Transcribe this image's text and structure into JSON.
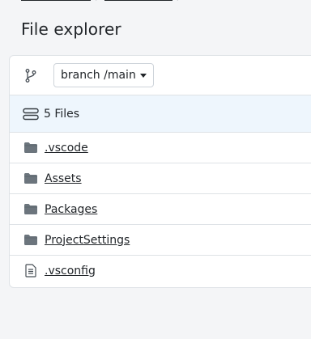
{
  "breadcrumb": {
    "items": [
      "",
      ""
    ],
    "separator": "/"
  },
  "page_title": "File explorer",
  "toolbar": {
    "branch_label": "branch /main",
    "branch_icon": "git-branch-icon"
  },
  "files_header": {
    "label": "5 Files",
    "icon": "stack-icon"
  },
  "files": [
    {
      "name": ".vscode",
      "type": "folder",
      "icon": "folder-icon"
    },
    {
      "name": "Assets",
      "type": "folder",
      "icon": "folder-icon"
    },
    {
      "name": "Packages",
      "type": "folder",
      "icon": "folder-icon"
    },
    {
      "name": "ProjectSettings",
      "type": "folder",
      "icon": "folder-icon"
    },
    {
      "name": ".vsconfig",
      "type": "file",
      "icon": "file-text-icon"
    }
  ],
  "colors": {
    "background": "#f4f5f7",
    "card": "#ffffff",
    "header_highlight": "#eef6fd",
    "border": "#dee2e6",
    "icon": "#6c757d"
  }
}
